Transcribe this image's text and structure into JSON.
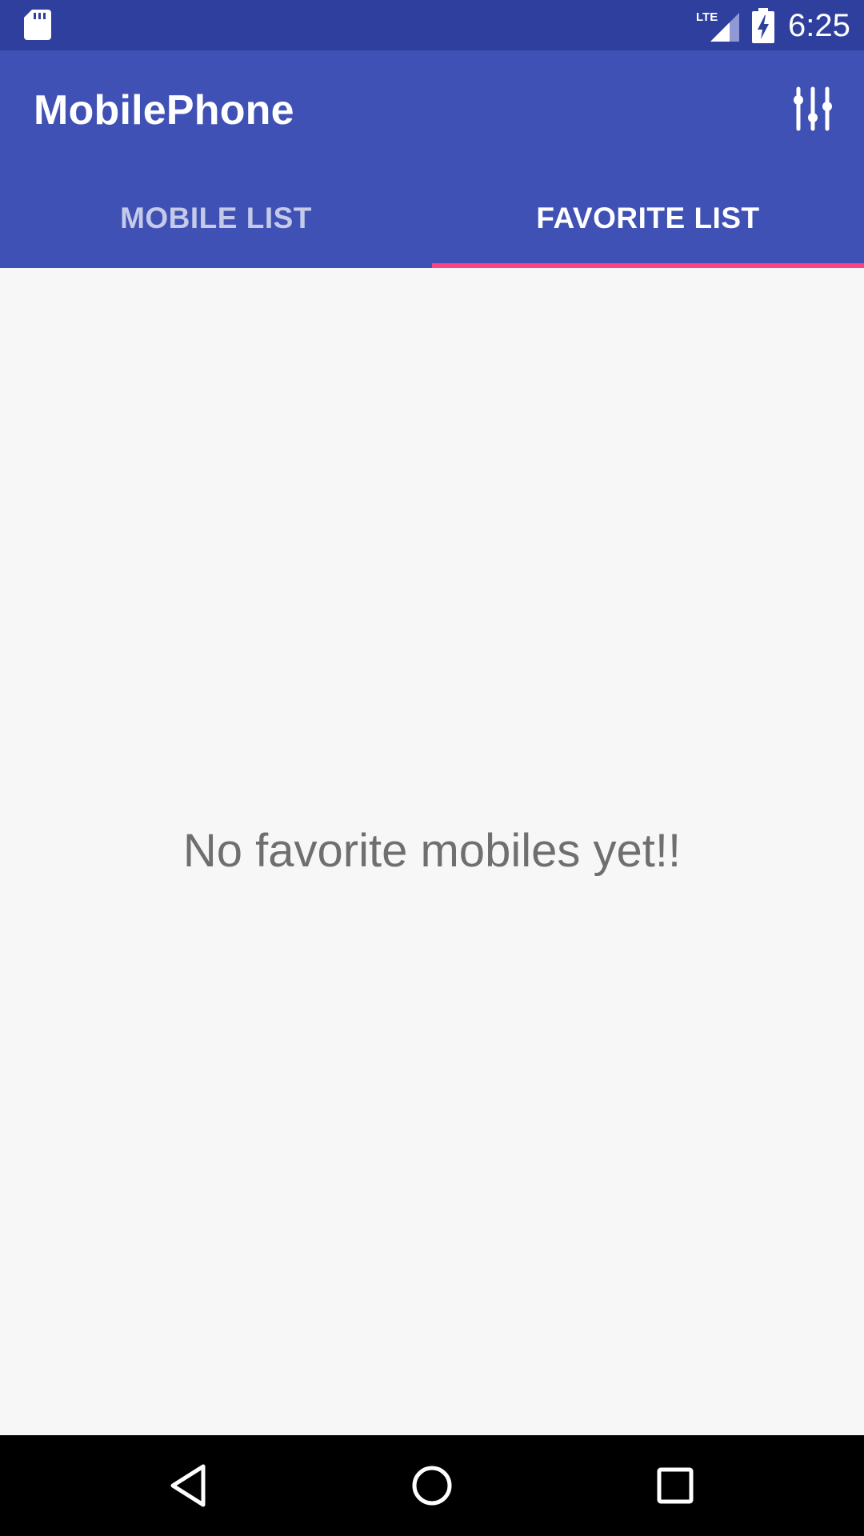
{
  "status_bar": {
    "time": "6:25",
    "network": "LTE",
    "icons": [
      "sd-card-icon",
      "signal-icon",
      "battery-charging-icon"
    ]
  },
  "app_bar": {
    "title": "MobilePhone",
    "action_icon": "sliders-icon"
  },
  "tabs": [
    {
      "label": "MOBILE LIST",
      "selected": false
    },
    {
      "label": "FAVORITE LIST",
      "selected": true
    }
  ],
  "content": {
    "empty_message": "No favorite mobiles yet!!"
  },
  "nav_bar": {
    "buttons": [
      "back-icon",
      "home-icon",
      "recents-icon"
    ]
  },
  "colors": {
    "status_bar": "#2f3f9e",
    "primary": "#3f51b5",
    "accent": "#ff4081",
    "background": "#f7f7f7"
  }
}
